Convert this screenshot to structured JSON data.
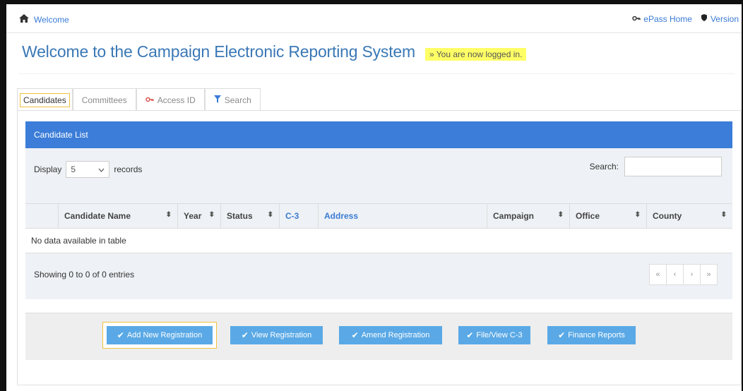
{
  "topbar": {
    "home_label": "Welcome",
    "epass_label": "ePass Home",
    "version_label": "Version"
  },
  "header": {
    "title": "Welcome to the Campaign Electronic Reporting System",
    "logged_in": "» You are now logged in."
  },
  "tabs": [
    {
      "label": "Candidates",
      "active": true
    },
    {
      "label": "Committees"
    },
    {
      "label": "Access ID",
      "icon": "key-icon"
    },
    {
      "label": "Search",
      "icon": "filter-icon"
    }
  ],
  "candidate_list": {
    "heading": "Candidate List",
    "display_label": "Display",
    "page_size": "5",
    "records_label": "records",
    "search_label": "Search:",
    "columns": [
      "Candidate Name",
      "Year",
      "Status",
      "C-3",
      "Address",
      "Campaign",
      "Office",
      "County"
    ],
    "empty_message": "No data available in table",
    "showing": "Showing 0 to 0 of 0 entries",
    "pager": [
      "«",
      "‹",
      "›",
      "»"
    ]
  },
  "actions": [
    "Add New Registration",
    "View Registration",
    "Amend Registration",
    "File/View C-3",
    "Finance Reports"
  ],
  "colors": {
    "accent": "#3b7dd8",
    "button": "#5aa9e6",
    "highlight": "#ffff66",
    "focus_outline": "#f0c040"
  }
}
